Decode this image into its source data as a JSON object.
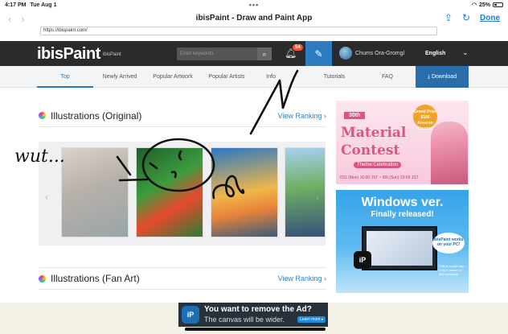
{
  "status_bar": {
    "time": "4:17 PM",
    "date": "Tue Aug 1",
    "battery": "25%"
  },
  "browser": {
    "title": "ibisPaint - Draw and Paint App",
    "url": "https://ibispaint.com/",
    "done_label": "Done"
  },
  "header": {
    "logo_text": "ibisPaint",
    "logo_subtitle": "ibisPaint",
    "search_placeholder": "Enter keywords",
    "notification_count": "54",
    "username": "Chums Ora-Gromgl",
    "language": "English"
  },
  "tabs": [
    {
      "label": "Top"
    },
    {
      "label": "Newly Arrived"
    },
    {
      "label": "Popular Artwork"
    },
    {
      "label": "Popular Artists"
    },
    {
      "label": "Info"
    },
    {
      "label": "Tutorials"
    },
    {
      "label": "FAQ"
    },
    {
      "label": "Download"
    }
  ],
  "sections": [
    {
      "title": "Illustrations (Original)",
      "link": "View Ranking"
    },
    {
      "title": "Illustrations (Fan Art)",
      "link": "View Ranking"
    }
  ],
  "ads": {
    "contest": {
      "badge": "30th",
      "title_line1": "Material",
      "title_line2": "Contest",
      "theme": "Theme:Celebration",
      "dates": "7/31 (Mon) 16:00 JST ~ 8/6 (Sun) 23:59 JST",
      "prize": "Grand Prize $100 Amazon Coupon"
    },
    "windows": {
      "headline": "Windows ver.",
      "subline": "Finally released!",
      "bubble": "ibisPaint works on your PC!",
      "note": "This is a paid app. A free version is also available."
    }
  },
  "banner": {
    "line1": "You want to remove the Ad?",
    "line2": "The canvas will be wider.",
    "button": "Learn more ▸"
  },
  "annotation_text": "wut..."
}
